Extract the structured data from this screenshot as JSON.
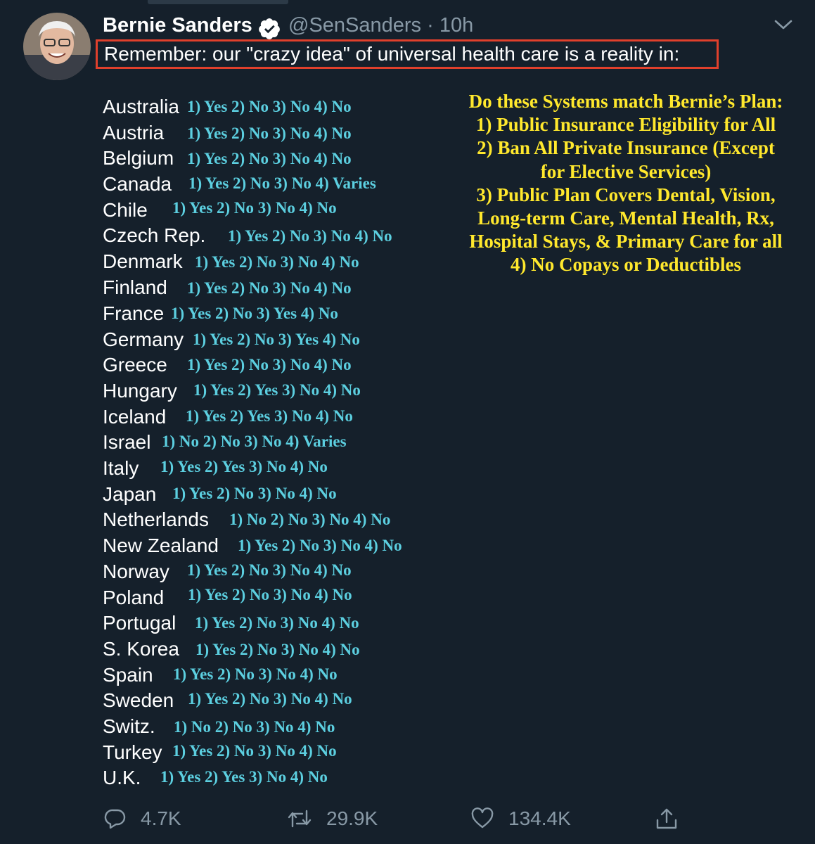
{
  "tweet": {
    "author_name": "Bernie Sanders",
    "handle": "@SenSanders",
    "time": "· 10h",
    "text": "Remember: our \"crazy idea\" of universal health care is a reality in:"
  },
  "countries": [
    {
      "name": "Australia",
      "answers": "1) Yes 2) No 3) No 4) No"
    },
    {
      "name": "Austria",
      "answers": "1) Yes 2) No 3) No 4) No"
    },
    {
      "name": "Belgium",
      "answers": "1) Yes 2) No 3) No 4) No"
    },
    {
      "name": "Canada",
      "answers": "1) Yes 2) No 3) No 4) Varies"
    },
    {
      "name": "Chile",
      "answers": "1) Yes 2) No 3) No 4) No"
    },
    {
      "name": "Czech Rep.",
      "answers": "1) Yes 2) No 3) No 4) No"
    },
    {
      "name": "Denmark",
      "answers": "1) Yes 2) No 3) No 4) No"
    },
    {
      "name": "Finland",
      "answers": "1) Yes 2) No 3) No 4) No"
    },
    {
      "name": "France",
      "answers": "1) Yes 2) No 3) Yes 4) No"
    },
    {
      "name": "Germany",
      "answers": "1) Yes 2) No 3) Yes 4) No"
    },
    {
      "name": "Greece",
      "answers": "1) Yes 2) No 3) No 4) No"
    },
    {
      "name": "Hungary",
      "answers": "1) Yes 2) Yes 3) No 4) No"
    },
    {
      "name": "Iceland",
      "answers": "1) Yes 2) Yes 3) No 4) No"
    },
    {
      "name": "Israel",
      "answers": "1) No 2) No 3) No 4) Varies"
    },
    {
      "name": "Italy",
      "answers": "1) Yes 2) Yes 3) No 4) No"
    },
    {
      "name": "Japan",
      "answers": "1) Yes 2) No 3) No 4) No"
    },
    {
      "name": "Netherlands",
      "answers": "1) No 2) No 3) No 4) No"
    },
    {
      "name": "New Zealand",
      "answers": "1) Yes 2) No 3) No 4) No"
    },
    {
      "name": "Norway",
      "answers": "1) Yes 2) No 3) No 4) No"
    },
    {
      "name": "Poland",
      "answers": "1) Yes 2) No 3) No 4) No"
    },
    {
      "name": "Portugal",
      "answers": "1) Yes 2) No 3) No 4) No"
    },
    {
      "name": "S. Korea",
      "answers": "1) Yes 2) No 3) No 4) No"
    },
    {
      "name": "Spain",
      "answers": "1) Yes 2) No 3) No 4) No"
    },
    {
      "name": "Sweden",
      "answers": "1) Yes 2) No 3) No 4) No"
    },
    {
      "name": "Switz.",
      "answers": "1) No 2) No 3) No 4) No"
    },
    {
      "name": "Turkey",
      "answers": "1) Yes 2) No 3) No 4) No"
    },
    {
      "name": "U.K.",
      "answers": "1) Yes 2) Yes 3) No 4) No"
    }
  ],
  "legend": {
    "lines": [
      "Do these Systems match Bernie’s Plan:",
      "1) Public Insurance Eligibility for All",
      "2) Ban All Private Insurance (Except",
      "for Elective Services)",
      "3) Public Plan Covers Dental, Vision,",
      "Long-term Care, Mental Health, Rx,",
      "Hospital Stays, & Primary Care for all",
      "4) No Copays or Deductibles"
    ]
  },
  "actions": {
    "reply_count": "4.7K",
    "retweet_count": "29.9K",
    "like_count": "134.4K"
  },
  "icons": {
    "verified": "verified-badge-icon",
    "menu": "chevron-down-icon",
    "reply": "reply-icon",
    "retweet": "retweet-icon",
    "like": "heart-icon",
    "share": "share-icon"
  },
  "colors": {
    "background": "#15202b",
    "answer_text": "#5ccfe0",
    "legend_text": "#ffe82d",
    "highlight_border": "#e0402c",
    "muted": "#8899a6"
  }
}
